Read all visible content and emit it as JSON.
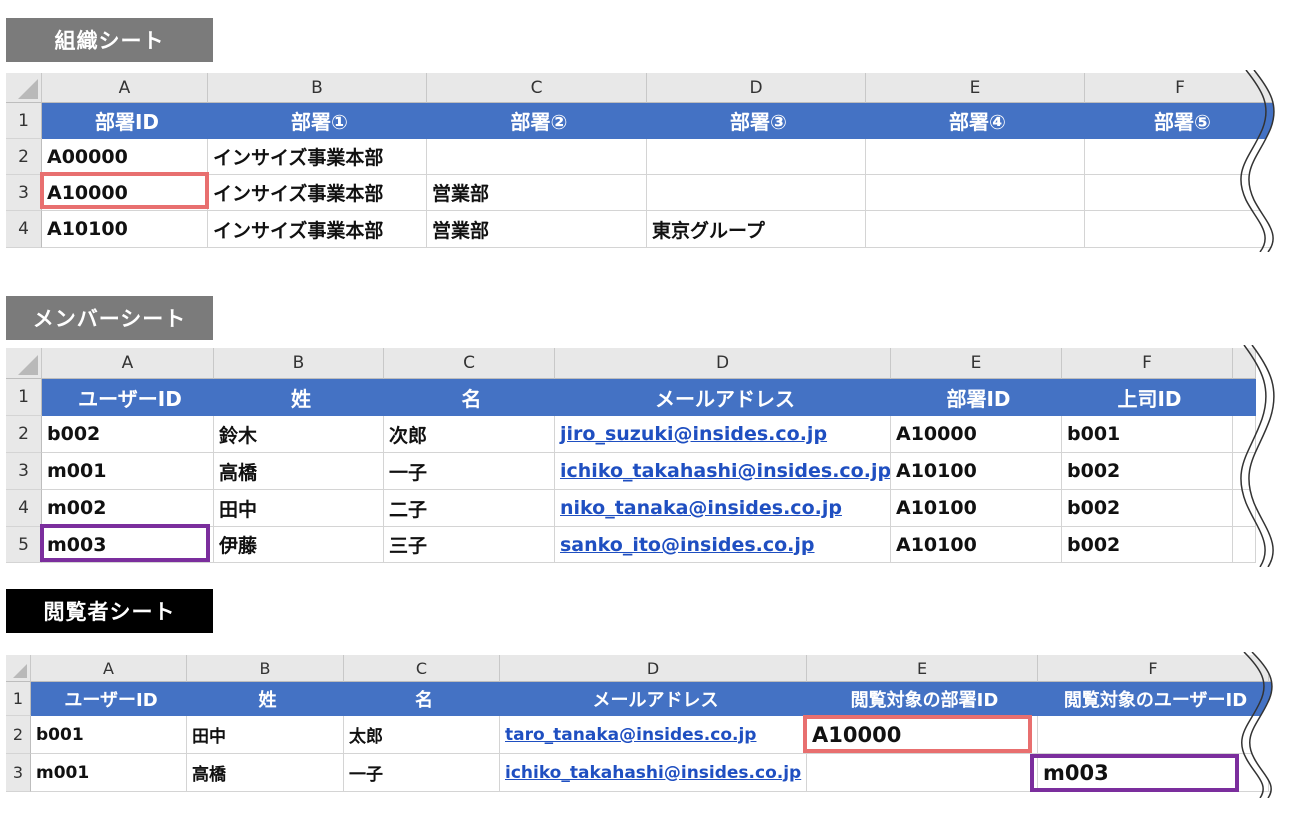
{
  "sheet1": {
    "title": "組織シート",
    "col_letters": [
      "A",
      "B",
      "C",
      "D",
      "E",
      "F"
    ],
    "row_numbers": [
      "1",
      "2",
      "3",
      "4"
    ],
    "headers": [
      "部署ID",
      "部署①",
      "部署②",
      "部署③",
      "部署④",
      "部署⑤"
    ],
    "rows": [
      [
        "A00000",
        "インサイズ事業本部",
        "",
        "",
        "",
        ""
      ],
      [
        "A10000",
        "インサイズ事業本部",
        "営業部",
        "",
        "",
        ""
      ],
      [
        "A10100",
        "インサイズ事業本部",
        "営業部",
        "東京グループ",
        "",
        ""
      ]
    ]
  },
  "sheet2": {
    "title": "メンバーシート",
    "col_letters": [
      "A",
      "B",
      "C",
      "D",
      "E",
      "F"
    ],
    "row_numbers": [
      "1",
      "2",
      "3",
      "4",
      "5"
    ],
    "headers": [
      "ユーザーID",
      "姓",
      "名",
      "メールアドレス",
      "部署ID",
      "上司ID"
    ],
    "rows": [
      [
        "b002",
        "鈴木",
        "次郎",
        "jiro_suzuki@insides.co.jp",
        "A10000",
        "b001"
      ],
      [
        "m001",
        "高橋",
        "一子",
        "ichiko_takahashi@insides.co.jp",
        "A10100",
        "b002"
      ],
      [
        "m002",
        "田中",
        "二子",
        "niko_tanaka@insides.co.jp",
        "A10100",
        "b002"
      ],
      [
        "m003",
        "伊藤",
        "三子",
        "sanko_ito@insides.co.jp",
        "A10100",
        "b002"
      ]
    ]
  },
  "sheet3": {
    "title": "閲覧者シート",
    "col_letters": [
      "A",
      "B",
      "C",
      "D",
      "E",
      "F"
    ],
    "row_numbers": [
      "1",
      "2",
      "3"
    ],
    "headers": [
      "ユーザーID",
      "姓",
      "名",
      "メールアドレス",
      "閲覧対象の部署ID",
      "閲覧対象のユーザーID"
    ],
    "rows": [
      [
        "b001",
        "田中",
        "太郎",
        "taro_tanaka@insides.co.jp",
        "A10000",
        ""
      ],
      [
        "m001",
        "高橋",
        "一子",
        "ichiko_takahashi@insides.co.jp",
        "",
        "m003"
      ]
    ]
  },
  "colors": {
    "header_blue": "#4472c4",
    "highlight_red": "#e86f6f",
    "highlight_purple": "#7b2e9d",
    "link": "#1f4fc1"
  }
}
